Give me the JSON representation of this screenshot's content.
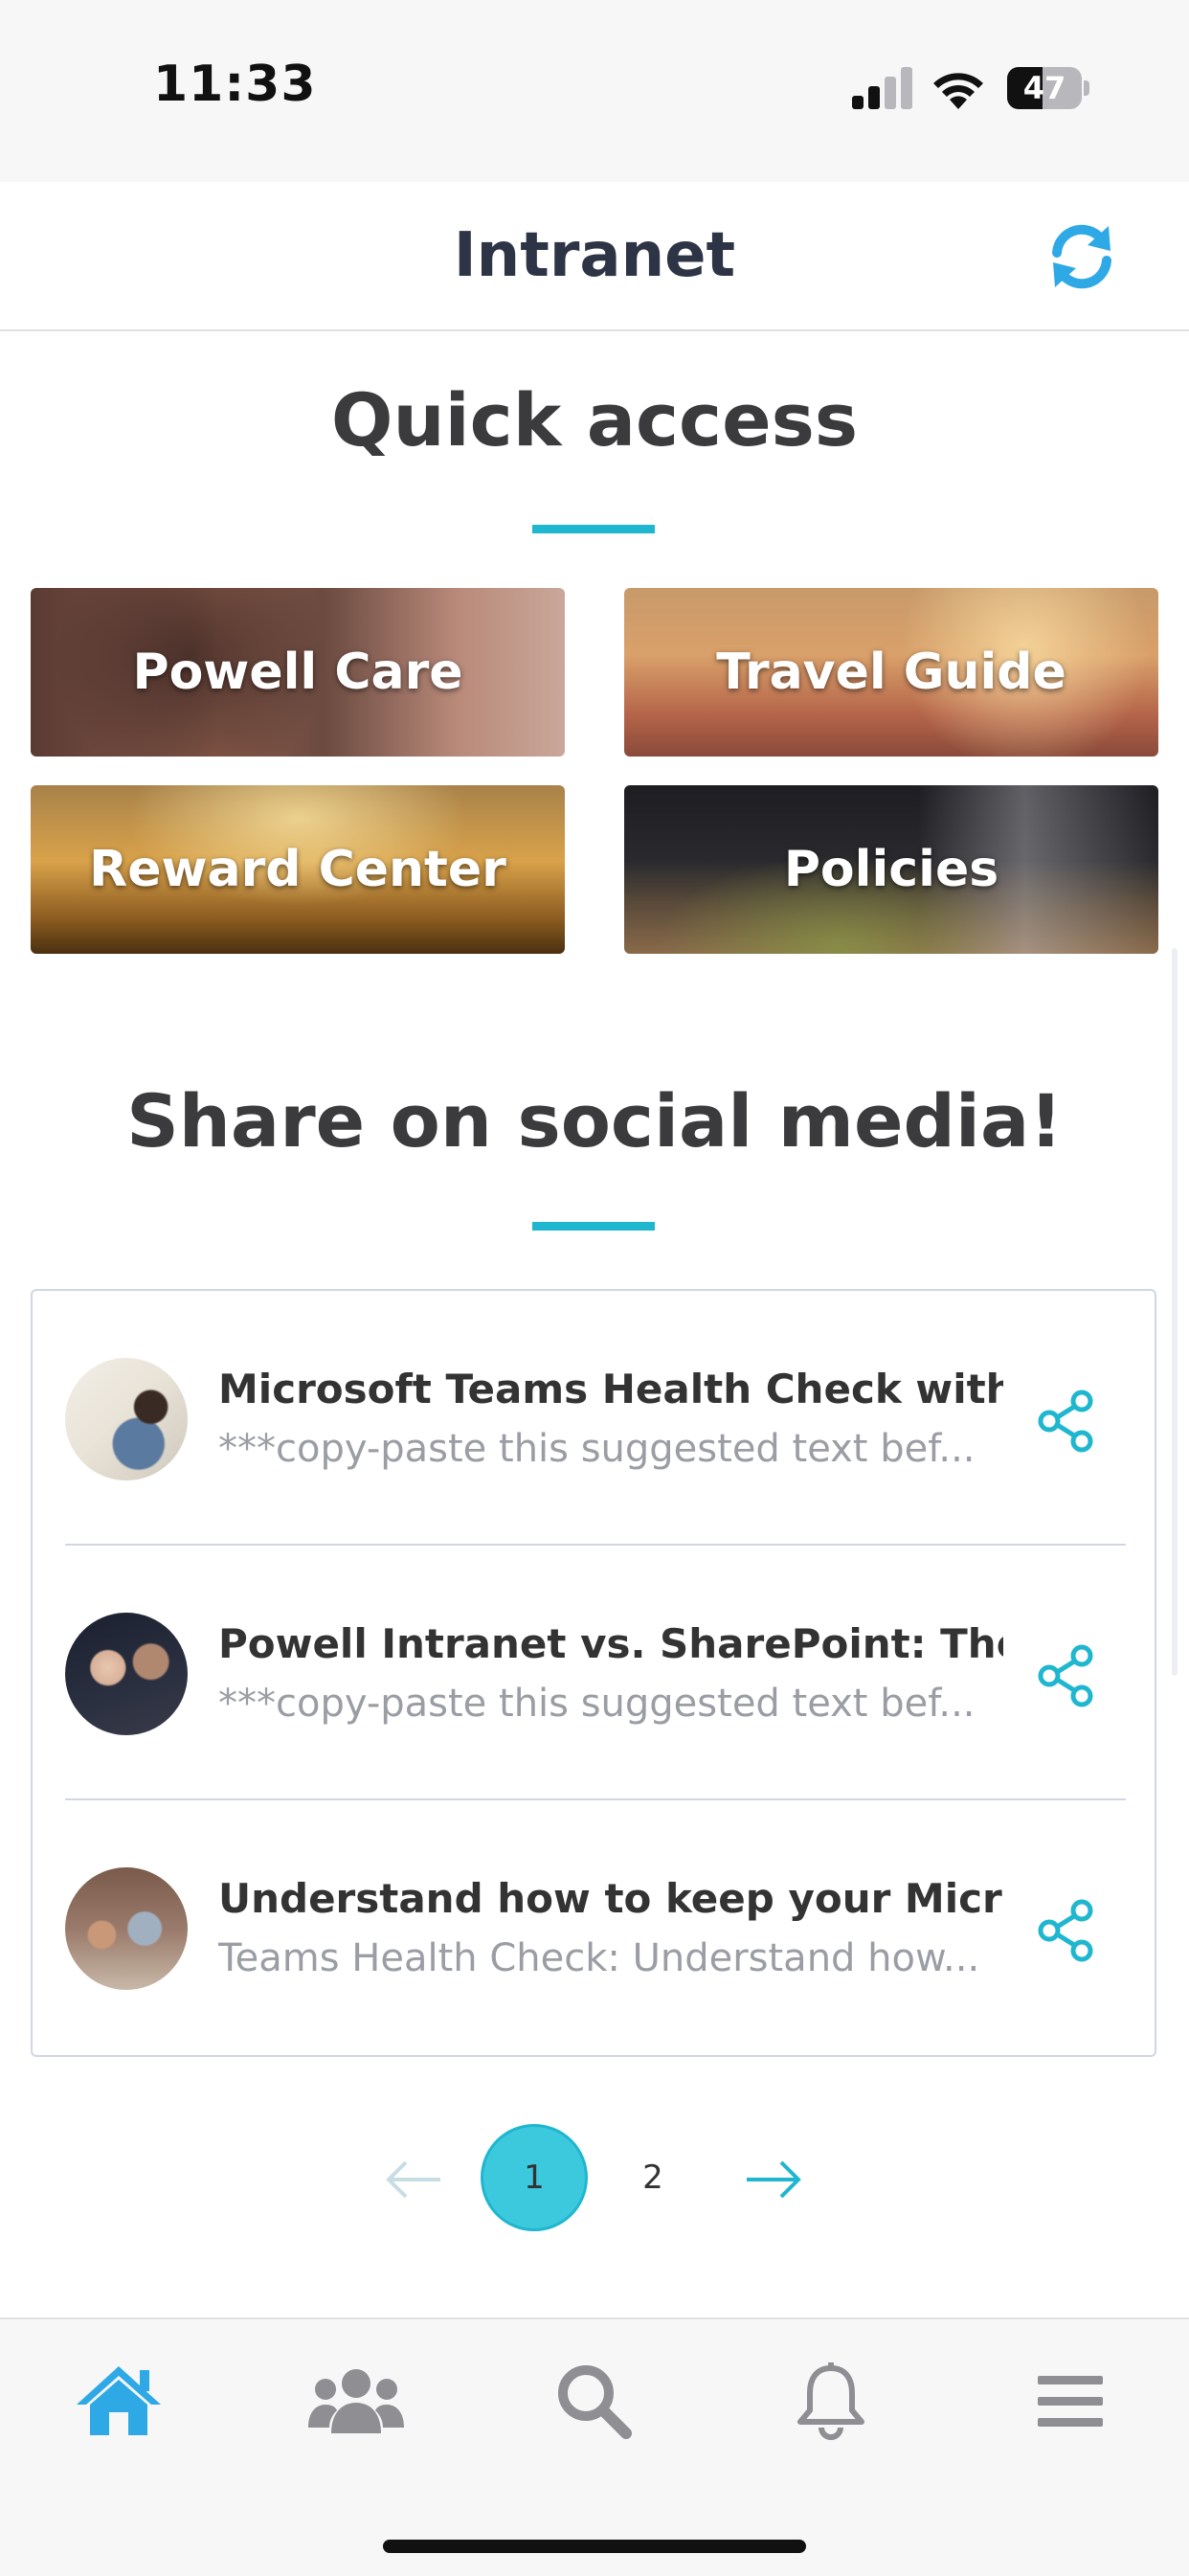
{
  "status_bar": {
    "time": "11:33",
    "battery": "47",
    "battery_level": 0.47
  },
  "header": {
    "title": "Intranet",
    "refresh_icon": "refresh-icon"
  },
  "quick_access": {
    "title": "Quick access",
    "tiles": [
      {
        "label": "Powell Care"
      },
      {
        "label": "Travel Guide"
      },
      {
        "label": "Reward Center"
      },
      {
        "label": "Policies"
      }
    ]
  },
  "social": {
    "title": "Share on social media!",
    "items": [
      {
        "title": "Microsoft Teams Health Check with P...",
        "description": "***copy-paste this suggested text bef..."
      },
      {
        "title": "Powell Intranet vs. SharePoint: The C...",
        "description": "***copy-paste this suggested text bef..."
      },
      {
        "title": "Understand how to keep your Micros...",
        "description": "Teams Health Check: Understand how..."
      }
    ],
    "share_icon": "share-icon"
  },
  "pagination": {
    "pages": [
      "1",
      "2"
    ],
    "current": "1"
  },
  "tab_bar": {
    "items": [
      {
        "icon": "home-icon",
        "active": true
      },
      {
        "icon": "people-icon",
        "active": false
      },
      {
        "icon": "search-icon",
        "active": false
      },
      {
        "icon": "bell-icon",
        "active": false
      },
      {
        "icon": "menu-icon",
        "active": false
      }
    ]
  },
  "colors": {
    "accent": "#1fb6cf",
    "active_tab": "#2fa9e6",
    "inactive_tab": "#8e8e93"
  }
}
